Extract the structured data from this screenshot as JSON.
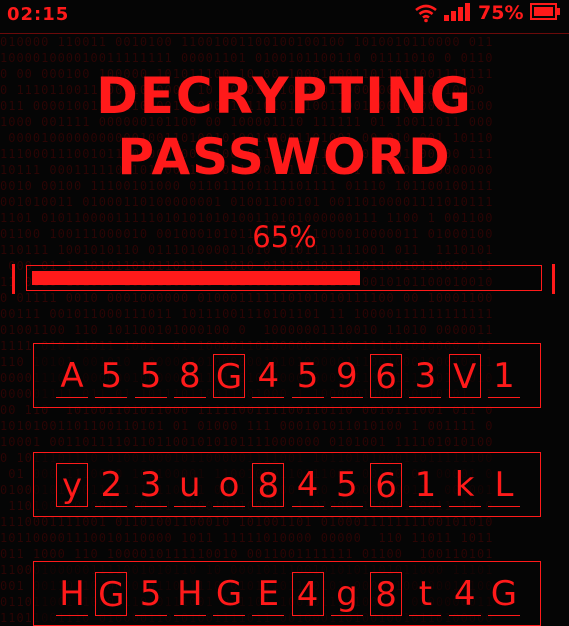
{
  "status_bar": {
    "time": "02:15",
    "battery_percent": "75%",
    "icons": [
      "wifi-icon",
      "signal-icon",
      "battery-icon"
    ],
    "accent_color": "#ff1a1a"
  },
  "title": {
    "line1": "DECRYPTING",
    "line2": "PASSWORD"
  },
  "progress": {
    "label": "65%",
    "value": 0.65
  },
  "codes": [
    {
      "chars": [
        "A",
        "5",
        "5",
        "8",
        "G",
        "4",
        "5",
        "9",
        "6",
        "3",
        "V",
        "1"
      ],
      "boxed": [
        4,
        8,
        10
      ]
    },
    {
      "chars": [
        "y",
        "2",
        "3",
        "u",
        "o",
        "8",
        "4",
        "5",
        "6",
        "1",
        "k",
        "L"
      ],
      "boxed": [
        0,
        5,
        8
      ]
    },
    {
      "chars": [
        "H",
        "G",
        "5",
        "H",
        "G",
        "E",
        "4",
        "g",
        "8",
        "t",
        "4",
        "G"
      ],
      "boxed": [
        1,
        6,
        8
      ]
    }
  ]
}
